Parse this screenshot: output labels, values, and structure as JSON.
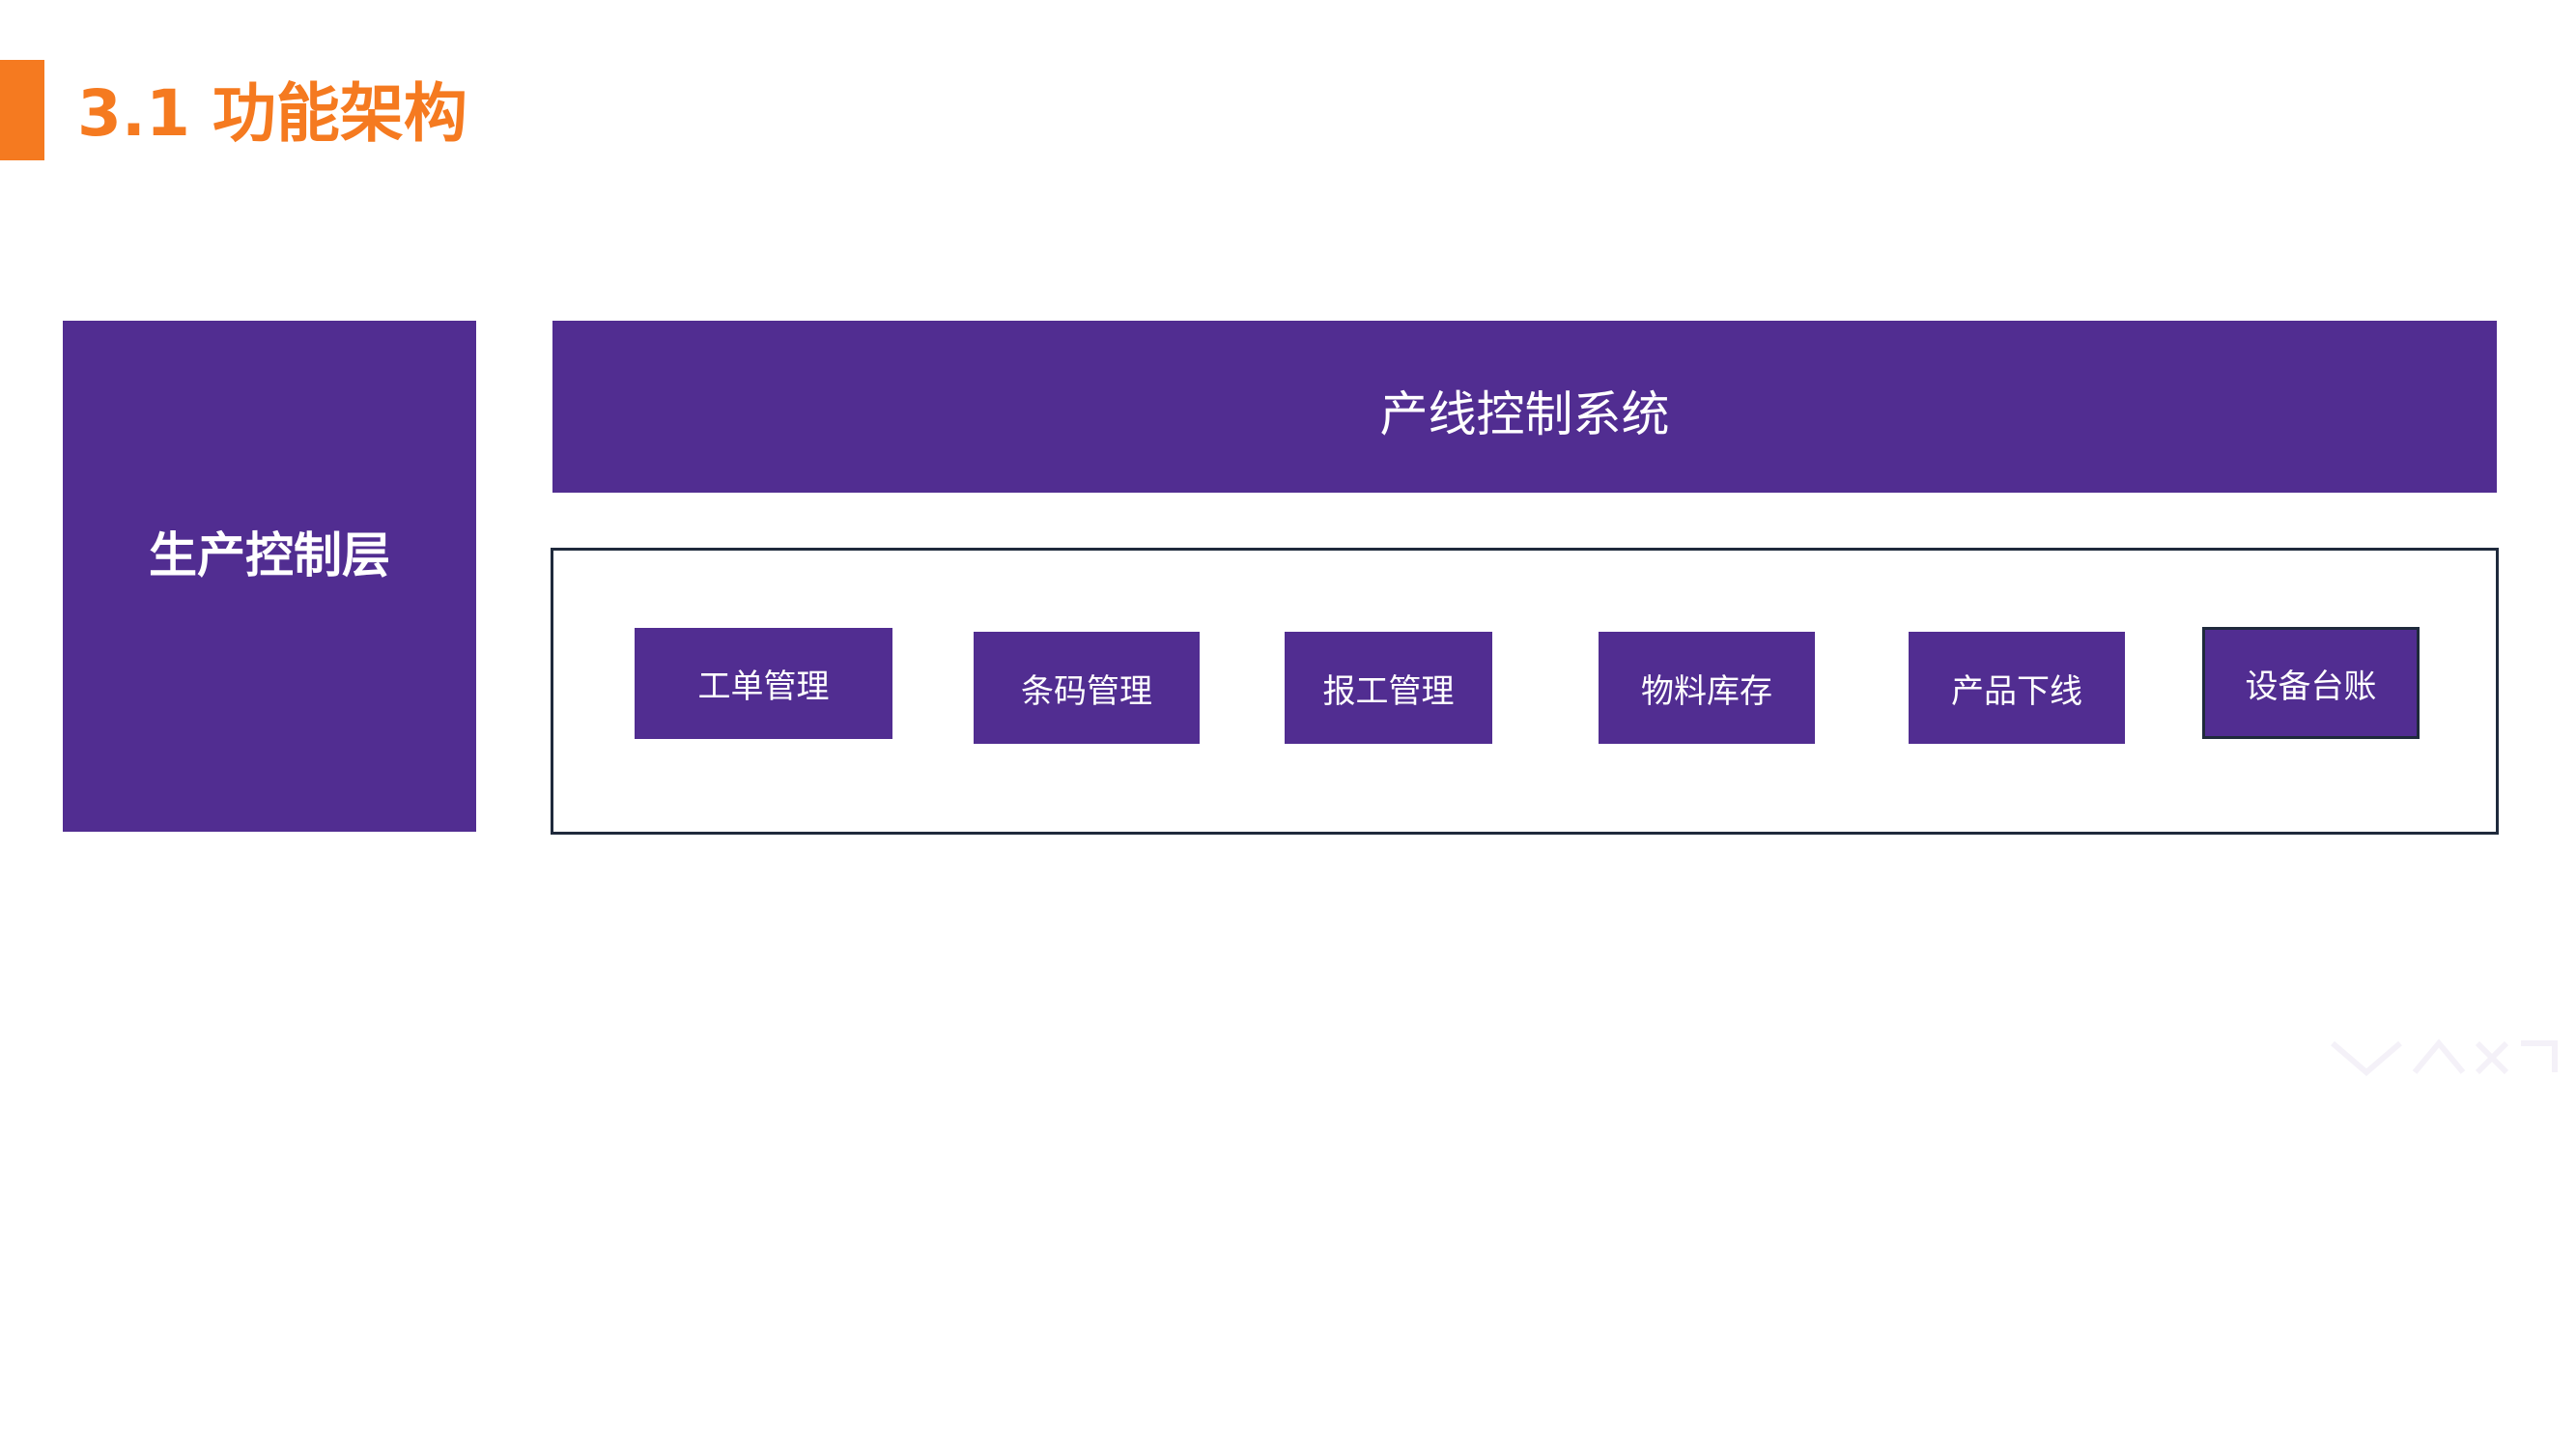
{
  "title": "3.1 功能架构",
  "layer": {
    "label": "生产控制层"
  },
  "system": {
    "label": "产线控制系统"
  },
  "modules": [
    {
      "label": "工单管理"
    },
    {
      "label": "条码管理"
    },
    {
      "label": "报工管理"
    },
    {
      "label": "物料库存"
    },
    {
      "label": "产品下线"
    },
    {
      "label": "设备台账"
    }
  ],
  "colors": {
    "accent": "#f57a20",
    "primary": "#512d91",
    "border": "#1f2a3c",
    "text_on_primary": "#ffffff"
  }
}
